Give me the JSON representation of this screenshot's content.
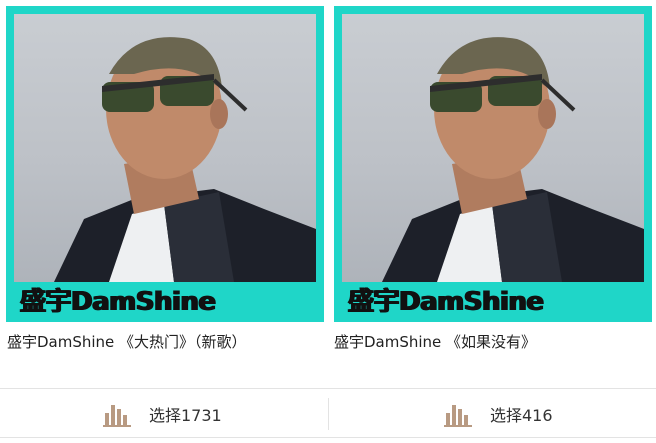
{
  "cards": [
    {
      "cover_text": "盛宇DamShine",
      "title": "盛宇DamShine 《大热门》（新歌）",
      "vote_label": "选择1731"
    },
    {
      "cover_text": "盛宇DamShine",
      "title": "盛宇DamShine 《如果没有》",
      "vote_label": "选择416"
    }
  ],
  "colors": {
    "cover_frame": "#1fd6c8",
    "vote_icon": "#b89a82"
  },
  "icons": {
    "vote": "bar-chart-icon"
  }
}
